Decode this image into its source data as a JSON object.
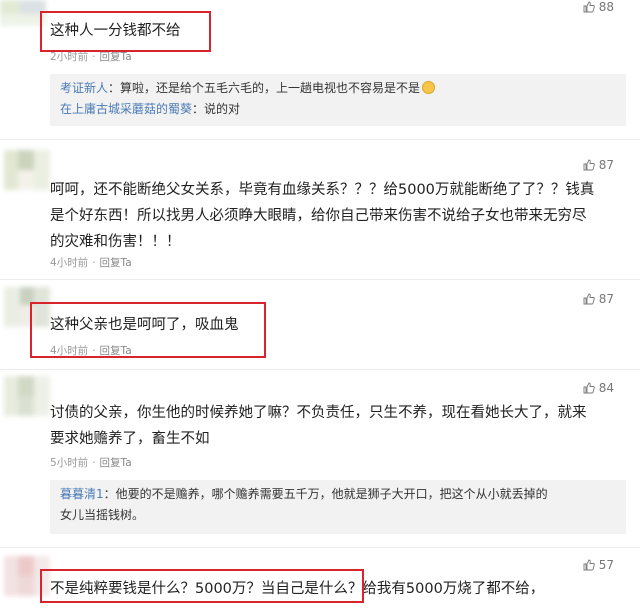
{
  "comments": [
    {
      "likes": "88",
      "text": [
        "这种人一分钱都不给"
      ],
      "time": "2小时前",
      "reply": "回复Ta",
      "replies": [
        {
          "user": "考证新人",
          "sep": "：",
          "text": "算啦，还是给个五毛六毛的，上一趟电视也不容易是不是"
        },
        {
          "user": "在上庸古城采蘑菇的蜀葵",
          "sep": "：",
          "text": "说的对"
        }
      ]
    },
    {
      "likes": "87",
      "text": [
        "呵呵，还不能断绝父女关系，毕竟有血缘关系？？？给5000万就能断绝了了？？钱真",
        "是个好东西！所以找男人必须睁大眼睛，给你自己带来伤害不说给子女也带来无穷尽",
        "的灾难和伤害！！！"
      ],
      "time": "4小时前",
      "reply": "回复Ta"
    },
    {
      "likes": "87",
      "text": [
        "这种父亲也是呵呵了，吸血鬼"
      ],
      "time": "4小时前",
      "reply": "回复Ta"
    },
    {
      "likes": "84",
      "text": [
        "讨债的父亲，你生他的时候养她了嘛？不负责任，只生不养，现在看她长大了，就来",
        "要求她赡养了，畜生不如"
      ],
      "time": "5小时前",
      "reply": "回复Ta",
      "replies": [
        {
          "user": "暮暮清1",
          "sep": "：",
          "text": "他要的不是赡养，哪个赡养需要五千万，他就是狮子大开口，把这个从小就丢掉的",
          "text2": "女儿当摇钱树。"
        }
      ]
    },
    {
      "likes": "57",
      "text": [
        "不是纯粹要钱是什么？5000万？当自己是什么？给我有5000万烧了都不给，"
      ]
    }
  ],
  "sep": "·",
  "icons": {
    "like": "thumbs-up-icon"
  },
  "colors": {
    "highlight": "#d9232d",
    "username": "#4b7bb6"
  }
}
